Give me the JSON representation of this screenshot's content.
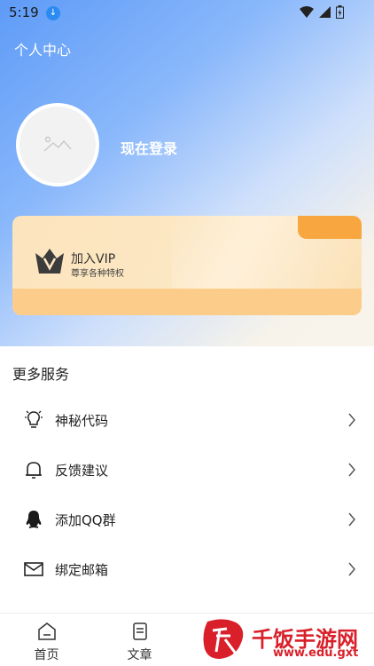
{
  "status_bar": {
    "time": "5:19"
  },
  "header": {
    "title": "个人中心"
  },
  "profile": {
    "login_label": "现在登录"
  },
  "vip": {
    "title": "加入VIP",
    "subtitle": "尊享各种特权"
  },
  "services": {
    "title": "更多服务",
    "items": [
      {
        "label": "神秘代码",
        "icon": "lightbulb-icon"
      },
      {
        "label": "反馈建议",
        "icon": "bell-icon"
      },
      {
        "label": "添加QQ群",
        "icon": "qq-icon"
      },
      {
        "label": "绑定邮箱",
        "icon": "mail-icon"
      }
    ]
  },
  "tabbar": {
    "tabs": [
      {
        "label": "首页",
        "icon": "home-icon"
      },
      {
        "label": "文章",
        "icon": "article-icon"
      },
      {
        "label": "",
        "icon": ""
      },
      {
        "label": "",
        "icon": ""
      }
    ]
  },
  "watermark": {
    "brand": "千饭手游网",
    "url": "www.edu.gxt"
  },
  "colors": {
    "accent": "#3b82f6",
    "vip_bg": "#fde8c5",
    "watermark_red": "#d9202a"
  }
}
